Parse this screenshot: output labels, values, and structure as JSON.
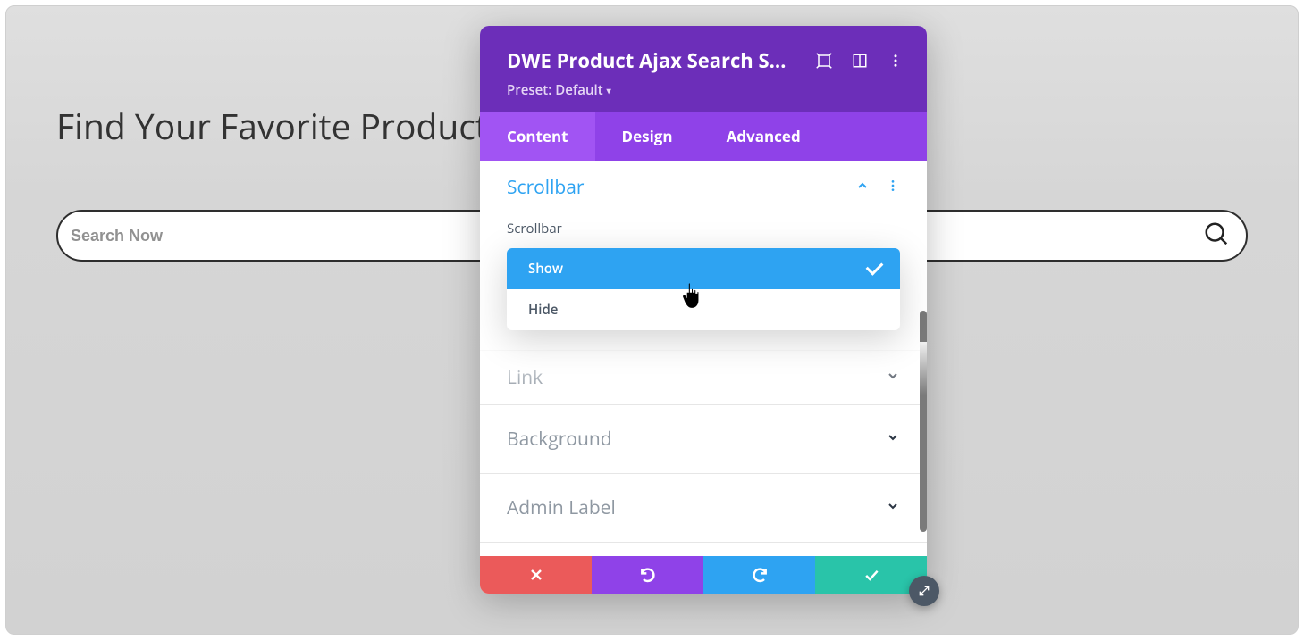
{
  "page": {
    "heading": "Find Your Favorite Products",
    "search_placeholder": "Search Now"
  },
  "modal": {
    "title": "DWE Product Ajax Search S…",
    "preset_label": "Preset: Default",
    "tabs": [
      {
        "label": "Content",
        "active": true
      },
      {
        "label": "Design",
        "active": false
      },
      {
        "label": "Advanced",
        "active": false
      }
    ],
    "sections": {
      "scrollbar": {
        "title": "Scrollbar",
        "field_label": "Scrollbar",
        "options": [
          {
            "label": "Show",
            "selected": true
          },
          {
            "label": "Hide",
            "selected": false
          }
        ]
      },
      "link": {
        "title": "Link"
      },
      "background": {
        "title": "Background"
      },
      "admin_label": {
        "title": "Admin Label"
      }
    },
    "colors": {
      "header": "#6c2eb9",
      "tabs": "#8f42e8",
      "tab_active": "#a154f3",
      "accent_blue": "#2ea3f2",
      "accent_green": "#29c4a9",
      "accent_red": "#eb5a5a"
    }
  }
}
